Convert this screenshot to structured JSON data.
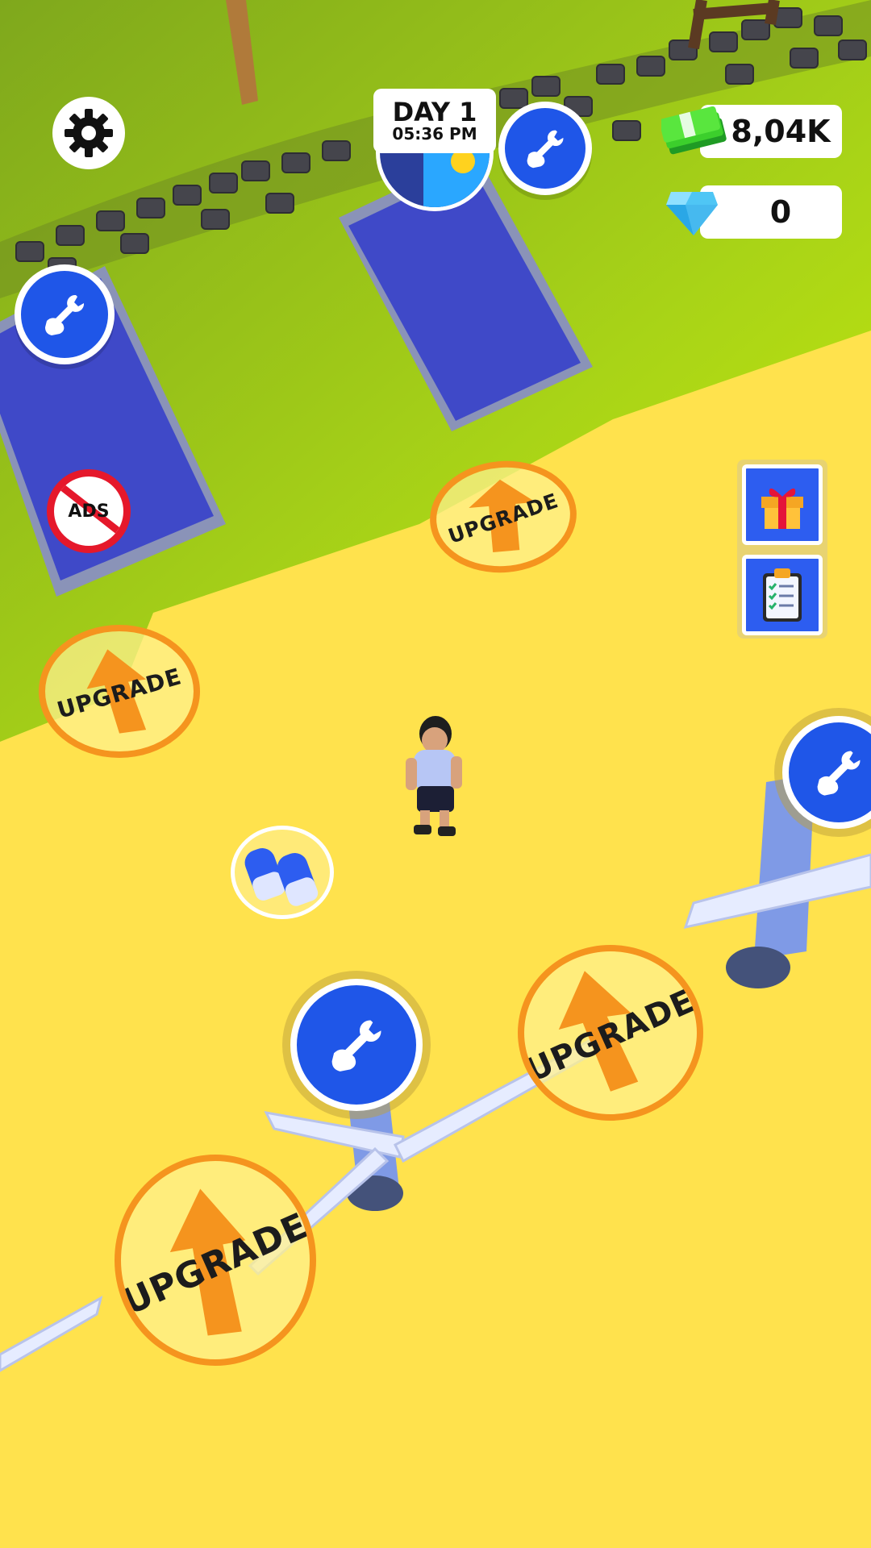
{
  "hud": {
    "day_label": "DAY 1",
    "time_label": "05:36 PM",
    "cash_value": "8,04K",
    "gems_value": "0",
    "ads_label": "ADS"
  },
  "world": {
    "upgrade_label": "UPGRADE"
  },
  "icons": {
    "settings": "gear-icon",
    "repair": "wrench-fist-icon",
    "gift": "gift-icon",
    "tasks": "clipboard-icon",
    "cash": "cash-icon",
    "gem": "diamond-icon",
    "no_ads": "no-ads-icon",
    "speed_boost": "sneakers-icon"
  },
  "colors": {
    "sand": "#ffe24d",
    "grass": "#a8d614",
    "accent_blue": "#1f56e8",
    "upgrade_orange": "#f5941e"
  }
}
